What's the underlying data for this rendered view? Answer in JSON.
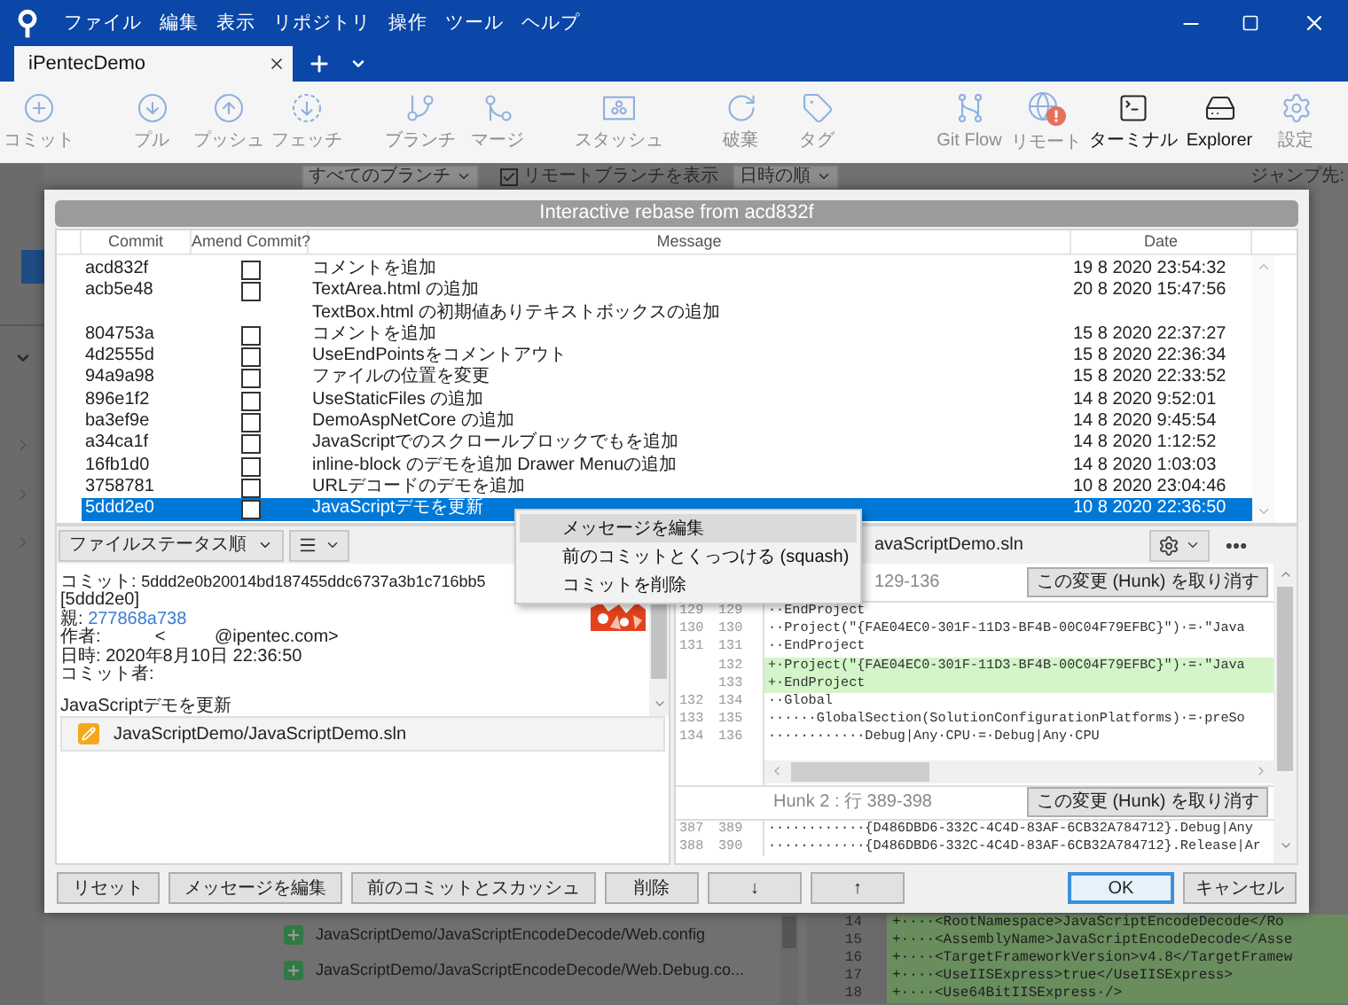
{
  "menu_bar": [
    "ファイル",
    "編集",
    "表示",
    "リポジトリ",
    "操作",
    "ツール",
    "ヘルプ"
  ],
  "tabs": [
    {
      "label": "iPentecDemo",
      "selected": true
    }
  ],
  "toolbar": {
    "groups": [
      [
        {
          "kind": "commit",
          "label": "コミット",
          "disabled": true
        }
      ],
      [
        {
          "kind": "pull",
          "label": "プル",
          "disabled": true
        },
        {
          "kind": "push",
          "label": "プッシュ",
          "disabled": true
        },
        {
          "kind": "fetch",
          "label": "フェッチ",
          "disabled": true
        }
      ],
      [
        {
          "kind": "branch",
          "label": "ブランチ",
          "disabled": true
        },
        {
          "kind": "merge",
          "label": "マージ",
          "disabled": true
        }
      ],
      [
        {
          "kind": "stash",
          "label": "スタッシュ",
          "disabled": true
        }
      ],
      [
        {
          "kind": "discard",
          "label": "破棄",
          "disabled": true
        },
        {
          "kind": "tag",
          "label": "タグ",
          "disabled": true
        }
      ]
    ],
    "right": [
      {
        "kind": "gitflow",
        "label": "Git Flow",
        "disabled": true
      },
      {
        "kind": "remote",
        "label": "リモート",
        "disabled": true
      },
      {
        "kind": "terminal",
        "label": "ターミナル",
        "disabled": false
      },
      {
        "kind": "explorer",
        "label": "Explorer",
        "disabled": false
      },
      {
        "kind": "settings",
        "label": "設定",
        "disabled": true
      }
    ]
  },
  "filters": {
    "branch": "すべてのブランチ",
    "show_remote": {
      "label": "リモートブランチを表示",
      "checked": true
    },
    "order": "日時の順",
    "jump": "ジャンプ先:"
  },
  "background_files": [
    {
      "path": "JavaScriptDemo/JavaScriptEncodeDecode/Web.config",
      "kind": "added"
    },
    {
      "path": "JavaScriptDemo/JavaScriptEncodeDecode/Web.Debug.co...",
      "kind": "added"
    }
  ],
  "background_diff": [
    {
      "line": "14",
      "kind": "added",
      "text": "+····<RootNamespace>JavaScriptEncodeDecode</Ro"
    },
    {
      "line": "15",
      "kind": "added",
      "text": "+····<AssemblyName>JavaScriptEncodeDecode</Asse"
    },
    {
      "line": "16",
      "kind": "added",
      "text": "+····<TargetFrameworkVersion>v4.8</TargetFramew"
    },
    {
      "line": "17",
      "kind": "added",
      "text": "+····<UseIISExpress>true</UseIISExpress>"
    },
    {
      "line": "18",
      "kind": "added",
      "text": "+····<Use64BitIISExpress·/>"
    }
  ],
  "rebase": {
    "title": "Interactive rebase from acd832f",
    "columns": [
      "Commit",
      "Amend Commit?",
      "Message",
      "Date"
    ],
    "rows": [
      {
        "commit": "acd832f",
        "amend": false,
        "message": "コメントを追加",
        "date": "19 8 2020 23:54:32",
        "selected": false
      },
      {
        "commit": "acb5e48",
        "amend": false,
        "message": "TextArea.html の追加\nTextBox.html の初期値ありテキストボックスの追加",
        "date": "20 8 2020 15:47:56",
        "selected": false
      },
      {
        "commit": "804753a",
        "amend": false,
        "message": "コメントを追加",
        "date": "15 8 2020 22:37:27",
        "selected": false
      },
      {
        "commit": "4d2555d",
        "amend": false,
        "message": "UseEndPointsをコメントアウト",
        "date": "15 8 2020 22:36:34",
        "selected": false
      },
      {
        "commit": "94a9a98",
        "amend": false,
        "message": "ファイルの位置を変更",
        "date": "15 8 2020 22:33:52",
        "selected": false
      },
      {
        "commit": "896e1f2",
        "amend": false,
        "message": "UseStaticFiles の追加",
        "date": "14 8 2020 9:52:01",
        "selected": false
      },
      {
        "commit": "ba3ef9e",
        "amend": false,
        "message": "DemoAspNetCore の追加",
        "date": "14 8 2020 9:45:54",
        "selected": false
      },
      {
        "commit": "a34ca1f",
        "amend": false,
        "message": "JavaScriptでのスクロールブロックでもを追加",
        "date": "14 8 2020 1:12:52",
        "selected": false
      },
      {
        "commit": "16fb1d0",
        "amend": false,
        "message": "inline-block のデモを追加 Drawer Menuの追加",
        "date": "14 8 2020 1:03:03",
        "selected": false
      },
      {
        "commit": "3758781",
        "amend": false,
        "message": "URLデコードのデモを追加",
        "date": "10 8 2020 23:04:46",
        "selected": false
      },
      {
        "commit": "5ddd2e0",
        "amend": false,
        "message": "JavaScriptデモを更新",
        "date": "10 8 2020 22:36:50",
        "selected": true
      }
    ],
    "context_menu": [
      {
        "label": "メッセージを編集",
        "highlighted": true
      },
      {
        "label": "前のコミットとくっつける (squash)",
        "highlighted": false
      },
      {
        "label": "コミットを削除",
        "highlighted": false
      }
    ],
    "sort": "ファイルステータス順",
    "details": [
      {
        "kind": "hash",
        "label": "コミット:",
        "value": "5ddd2e0b20014bd187455ddc6737a3b1c716bb5"
      },
      {
        "kind": "plain",
        "value": "[5ddd2e0]"
      },
      {
        "kind": "link",
        "label": "親:",
        "value": "277868a738"
      },
      {
        "kind": "plain",
        "label": "作者:",
        "value": "          <          @ipentec.com>"
      },
      {
        "kind": "plain",
        "label": "日時:",
        "value": "2020年8月10日 22:36:50"
      },
      {
        "kind": "plain",
        "label": "コミット者:"
      },
      {
        "kind": "blank"
      },
      {
        "kind": "plain",
        "value": "JavaScriptデモを更新"
      }
    ],
    "files": [
      {
        "path": "JavaScriptDemo/JavaScriptDemo.sln",
        "kind": "modified"
      }
    ],
    "diff": {
      "file": "avaScriptDemo.sln",
      "hunks": [
        {
          "title": "129-136",
          "button": "この変更 (Hunk) を取り消す",
          "lines": [
            {
              "old": "129",
              "new": "129",
              "kind": "context",
              "text": "··EndProject"
            },
            {
              "old": "130",
              "new": "130",
              "kind": "context",
              "text": "··Project(\"{FAE04EC0-301F-11D3-BF4B-00C04F79EFBC}\")·=·\"Java"
            },
            {
              "old": "131",
              "new": "131",
              "kind": "context",
              "text": "··EndProject"
            },
            {
              "new": "132",
              "kind": "added",
              "text": "+·Project(\"{FAE04EC0-301F-11D3-BF4B-00C04F79EFBC}\")·=·\"Java"
            },
            {
              "new": "133",
              "kind": "added",
              "text": "+·EndProject"
            },
            {
              "old": "132",
              "new": "134",
              "kind": "context",
              "text": "··Global"
            },
            {
              "old": "133",
              "new": "135",
              "kind": "context",
              "text": "······GlobalSection(SolutionConfigurationPlatforms)·=·preSo"
            },
            {
              "old": "134",
              "new": "136",
              "kind": "context",
              "text": "············Debug|Any·CPU·=·Debug|Any·CPU"
            }
          ]
        },
        {
          "title": "Hunk 2 : 行 389-398",
          "button": "この変更 (Hunk) を取り消す",
          "lines": [
            {
              "old": "387",
              "new": "389",
              "kind": "context",
              "text": "············{D486DBD6-332C-4C4D-83AF-6CB32A784712}.Debug|Any"
            },
            {
              "old": "388",
              "new": "390",
              "kind": "context",
              "text": "············{D486DBD6-332C-4C4D-83AF-6CB32A784712}.Release|Ar"
            }
          ]
        }
      ]
    },
    "buttons": [
      "リセット",
      "メッセージを編集",
      "前のコミットとスカッシュ",
      "削除",
      "↓",
      "↑"
    ],
    "confirm": [
      {
        "label": "OK",
        "default": true
      },
      {
        "label": "キャンセル",
        "default": false
      }
    ]
  }
}
